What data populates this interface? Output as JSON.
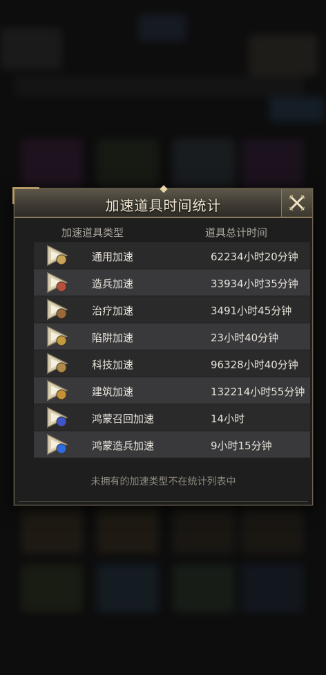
{
  "dialog": {
    "title": "加速道具时间统计",
    "columns": {
      "type": "加速道具类型",
      "total": "道具总计时间"
    },
    "items": [
      {
        "name": "通用加速",
        "time": "62234小时20分钟",
        "icon": "hourglass-speedup-icon",
        "accent": "#c8a35a"
      },
      {
        "name": "造兵加速",
        "time": "33934小时35分钟",
        "icon": "troop-speedup-icon",
        "accent": "#b5503d"
      },
      {
        "name": "治疗加速",
        "time": "3491小时45分钟",
        "icon": "heal-speedup-icon",
        "accent": "#9a6a3a"
      },
      {
        "name": "陷阱加速",
        "time": "23小时40分钟",
        "icon": "trap-speedup-icon",
        "accent": "#c49a3e"
      },
      {
        "name": "科技加速",
        "time": "96328小时40分钟",
        "icon": "tech-speedup-icon",
        "accent": "#b08a48"
      },
      {
        "name": "建筑加速",
        "time": "132214小时55分钟",
        "icon": "building-speedup-icon",
        "accent": "#c59138"
      },
      {
        "name": "鸿蒙召回加速",
        "time": "14小时",
        "icon": "hongmeng-recall-speedup-icon",
        "accent": "#3e56c8"
      },
      {
        "name": "鸿蒙造兵加速",
        "time": "9小时15分钟",
        "icon": "hongmeng-troop-speedup-icon",
        "accent": "#2f6be0"
      }
    ],
    "footnote": "未拥有的加速类型不在统计列表中"
  },
  "colors": {
    "title": "#f3ead6",
    "row_odd": "#2a2a2b",
    "row_even": "#39393c",
    "border": "#6f6652"
  }
}
